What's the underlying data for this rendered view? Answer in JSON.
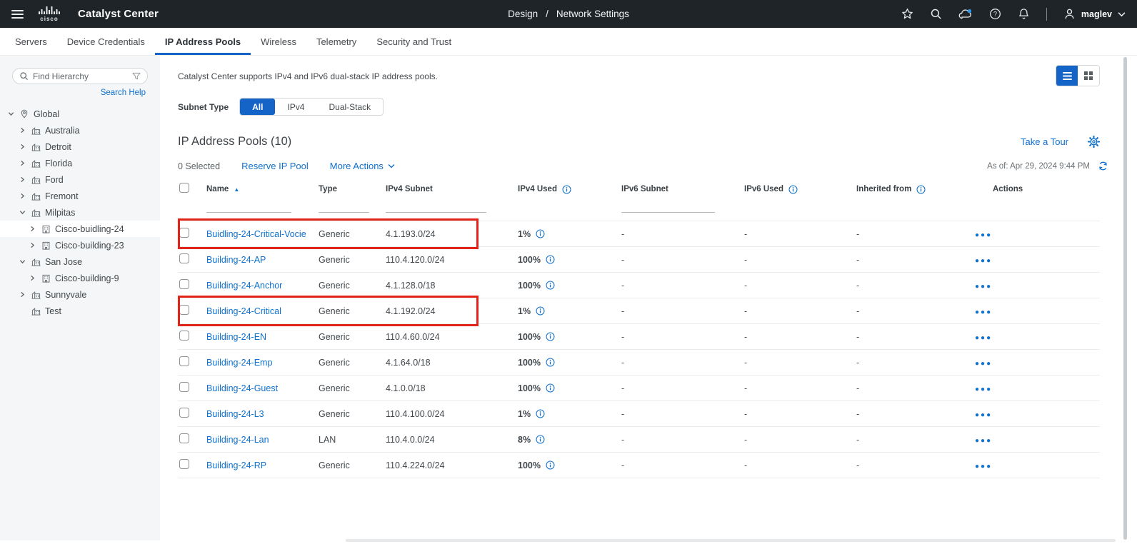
{
  "colors": {
    "accent_blue": "#1464c8",
    "link_blue": "#0e70cf",
    "header_bg": "#1f2428",
    "annotation_red": "#e2231a",
    "cloud_badge_blue": "#2b9af3"
  },
  "icons": {
    "header": [
      "hamburger-icon",
      "cisco-logo",
      "star-icon",
      "search-icon",
      "cloud-icon",
      "help-icon",
      "notifications-icon",
      "user-icon",
      "caret-down-icon"
    ],
    "sidebar": [
      "search-icon",
      "filter-icon",
      "chevron-down-icon",
      "chevron-right-icon",
      "location-icon",
      "site-icon",
      "building-icon"
    ],
    "main": [
      "list-view-icon",
      "grid-view-icon",
      "gear-icon",
      "refresh-icon",
      "info-icon",
      "sort-ascending-icon",
      "ellipsis-icon"
    ]
  },
  "header": {
    "product_name": "Catalyst Center",
    "logo_word": "cisco",
    "breadcrumb": {
      "section": "Design",
      "separator": "/",
      "page": "Network Settings"
    },
    "user": {
      "name": "maglev"
    }
  },
  "tabs": {
    "items": [
      {
        "label": "Servers",
        "active": false
      },
      {
        "label": "Device Credentials",
        "active": false
      },
      {
        "label": "IP Address Pools",
        "active": true
      },
      {
        "label": "Wireless",
        "active": false
      },
      {
        "label": "Telemetry",
        "active": false
      },
      {
        "label": "Security and Trust",
        "active": false
      }
    ]
  },
  "sidebar": {
    "search": {
      "placeholder": "Find Hierarchy"
    },
    "search_help_label": "Search Help",
    "tree": [
      {
        "label": "Global",
        "level": 0,
        "icon": "location",
        "expanded": true,
        "selected": false
      },
      {
        "label": "Australia",
        "level": 1,
        "icon": "site",
        "chevron": true,
        "selected": false
      },
      {
        "label": "Detroit",
        "level": 1,
        "icon": "site",
        "chevron": true,
        "selected": false
      },
      {
        "label": "Florida",
        "level": 1,
        "icon": "site",
        "chevron": true,
        "selected": false
      },
      {
        "label": "Ford",
        "level": 1,
        "icon": "site",
        "chevron": true,
        "selected": false
      },
      {
        "label": "Fremont",
        "level": 1,
        "icon": "site",
        "chevron": true,
        "selected": false
      },
      {
        "label": "Milpitas",
        "level": 1,
        "icon": "site",
        "expanded": true,
        "selected": false
      },
      {
        "label": "Cisco-buidling-24",
        "level": 2,
        "icon": "building",
        "chevron": true,
        "selected": true
      },
      {
        "label": "Cisco-building-23",
        "level": 2,
        "icon": "building",
        "chevron": true,
        "selected": false
      },
      {
        "label": "San Jose",
        "level": 1,
        "icon": "site",
        "expanded": true,
        "selected": false
      },
      {
        "label": "Cisco-building-9",
        "level": 2,
        "icon": "building",
        "chevron": true,
        "selected": false
      },
      {
        "label": "Sunnyvale",
        "level": 1,
        "icon": "site",
        "chevron": true,
        "selected": false
      },
      {
        "label": "Test",
        "level": 1,
        "icon": "site",
        "chevron": false,
        "selected": false
      }
    ]
  },
  "main": {
    "banner_text": "Catalyst Center supports IPv4 and IPv6 dual-stack IP address pools.",
    "subnet_type": {
      "label": "Subnet Type",
      "options": [
        "All",
        "IPv4",
        "Dual-Stack"
      ],
      "selected": "All"
    },
    "page_title": "IP Address Pools (10)",
    "take_a_tour_label": "Take a Tour",
    "toolbar": {
      "selected_count": "0 Selected",
      "reserve_label": "Reserve IP Pool",
      "more_actions_label": "More Actions",
      "as_of": "As of: Apr 29, 2024 9:44 PM"
    },
    "table": {
      "columns": [
        {
          "label": "Name",
          "sort": "asc",
          "filter": true
        },
        {
          "label": "Type",
          "filter": true
        },
        {
          "label": "IPv4 Subnet",
          "filter": true
        },
        {
          "label": "IPv4 Used",
          "info": true
        },
        {
          "label": "IPv6 Subnet",
          "filter": true
        },
        {
          "label": "IPv6 Used",
          "info": true
        },
        {
          "label": "Inherited from",
          "info": true
        },
        {
          "label": "Actions"
        }
      ],
      "rows": [
        {
          "name": "Buidling-24-Critical-Vocie",
          "type": "Generic",
          "ipv4_subnet": "4.1.193.0/24",
          "ipv4_used": "1%",
          "ipv6_subnet": "-",
          "ipv6_used": "-",
          "inherited_from": "-",
          "annotated": true
        },
        {
          "name": "Building-24-AP",
          "type": "Generic",
          "ipv4_subnet": "110.4.120.0/24",
          "ipv4_used": "100%",
          "ipv6_subnet": "-",
          "ipv6_used": "-",
          "inherited_from": "-",
          "annotated": false
        },
        {
          "name": "Building-24-Anchor",
          "type": "Generic",
          "ipv4_subnet": "4.1.128.0/18",
          "ipv4_used": "100%",
          "ipv6_subnet": "-",
          "ipv6_used": "-",
          "inherited_from": "-",
          "annotated": false
        },
        {
          "name": "Building-24-Critical",
          "type": "Generic",
          "ipv4_subnet": "4.1.192.0/24",
          "ipv4_used": "1%",
          "ipv6_subnet": "-",
          "ipv6_used": "-",
          "inherited_from": "-",
          "annotated": true
        },
        {
          "name": "Building-24-EN",
          "type": "Generic",
          "ipv4_subnet": "110.4.60.0/24",
          "ipv4_used": "100%",
          "ipv6_subnet": "-",
          "ipv6_used": "-",
          "inherited_from": "-",
          "annotated": false
        },
        {
          "name": "Building-24-Emp",
          "type": "Generic",
          "ipv4_subnet": "4.1.64.0/18",
          "ipv4_used": "100%",
          "ipv6_subnet": "-",
          "ipv6_used": "-",
          "inherited_from": "-",
          "annotated": false
        },
        {
          "name": "Building-24-Guest",
          "type": "Generic",
          "ipv4_subnet": "4.1.0.0/18",
          "ipv4_used": "100%",
          "ipv6_subnet": "-",
          "ipv6_used": "-",
          "inherited_from": "-",
          "annotated": false
        },
        {
          "name": "Building-24-L3",
          "type": "Generic",
          "ipv4_subnet": "110.4.100.0/24",
          "ipv4_used": "1%",
          "ipv6_subnet": "-",
          "ipv6_used": "-",
          "inherited_from": "-",
          "annotated": false
        },
        {
          "name": "Building-24-Lan",
          "type": "LAN",
          "ipv4_subnet": "110.4.0.0/24",
          "ipv4_used": "8%",
          "ipv6_subnet": "-",
          "ipv6_used": "-",
          "inherited_from": "-",
          "annotated": false
        },
        {
          "name": "Building-24-RP",
          "type": "Generic",
          "ipv4_subnet": "110.4.224.0/24",
          "ipv4_used": "100%",
          "ipv6_subnet": "-",
          "ipv6_used": "-",
          "inherited_from": "-",
          "annotated": false
        }
      ]
    }
  }
}
